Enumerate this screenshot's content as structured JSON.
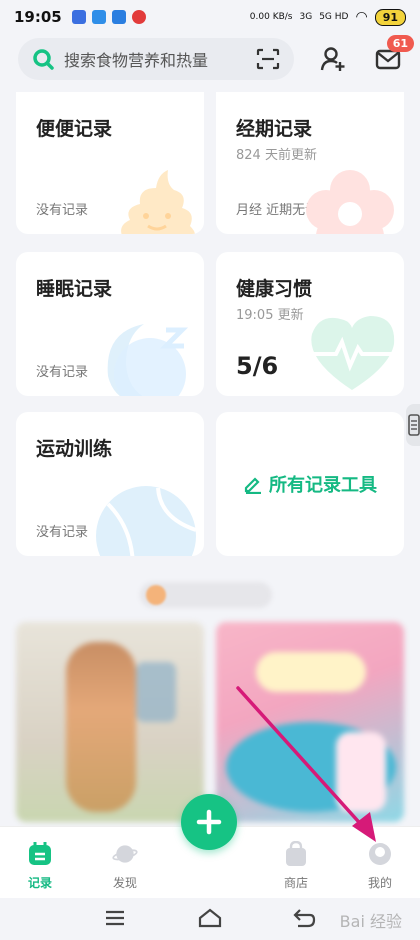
{
  "status_bar": {
    "time": "19:05",
    "net_speed": "0.00 KB/s",
    "signal_1": "3G",
    "signal_2": "5G HD",
    "battery": "91"
  },
  "search": {
    "placeholder": "搜索食物营养和热量"
  },
  "header": {
    "message_badge": "61"
  },
  "cards": [
    {
      "title": "便便记录",
      "foot": "没有记录"
    },
    {
      "title": "经期记录",
      "sub": "824 天前更新",
      "foot": "月经 近期无记录"
    },
    {
      "title": "睡眠记录",
      "foot": "没有记录"
    },
    {
      "title": "健康习惯",
      "sub": "19:05 更新",
      "big": "5/6"
    },
    {
      "title": "运动训练",
      "foot": "没有记录"
    }
  ],
  "all_tools": {
    "label": "所有记录工具"
  },
  "bottom_nav": {
    "items": [
      "记录",
      "发现",
      "商店",
      "我的"
    ]
  },
  "watermark": "Bai 经验",
  "colors": {
    "accent": "#16c384",
    "annotation_arrow": "#d61a78"
  }
}
